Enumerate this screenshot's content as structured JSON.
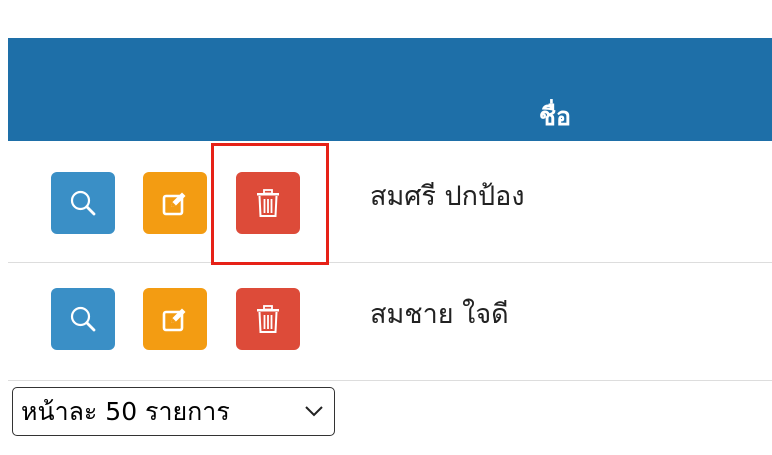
{
  "table": {
    "header": {
      "name_label": "ชื่อ"
    },
    "rows": [
      {
        "name": "สมศรี ปกป้อง",
        "actions": [
          "search-icon",
          "edit-icon",
          "trash-icon"
        ]
      },
      {
        "name": "สมชาย ใจดี",
        "actions": [
          "search-icon",
          "edit-icon",
          "trash-icon"
        ]
      }
    ]
  },
  "pagination": {
    "page_size_selected": "หน้าละ 50 รายการ"
  },
  "colors": {
    "header_bg": "#1e6fa8",
    "view_button": "#3a8fc6",
    "edit_button": "#f39c12",
    "delete_button": "#dd4b39",
    "highlight": "#e62117"
  },
  "annotation": {
    "highlighted_element": "row-1 delete button"
  }
}
